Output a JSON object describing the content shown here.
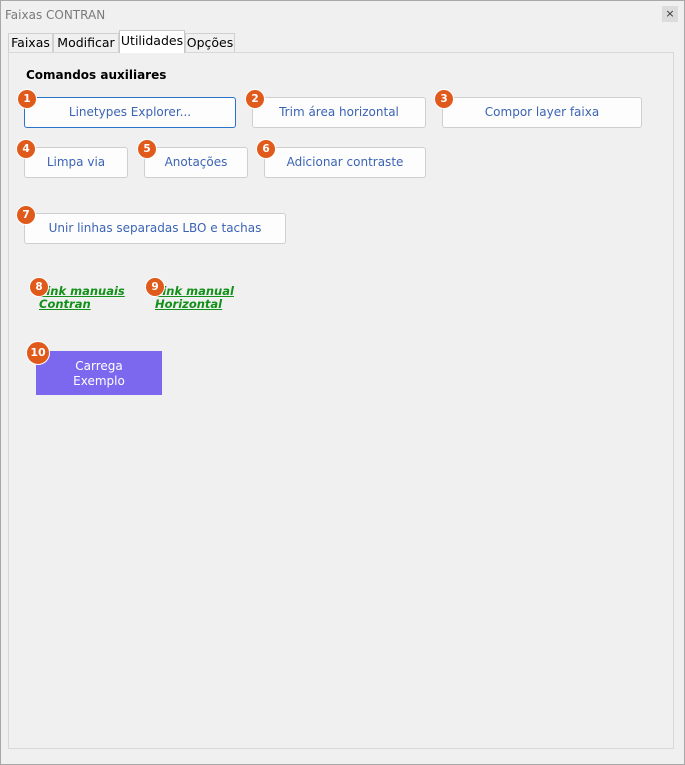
{
  "window": {
    "title": "Faixas CONTRAN",
    "close_label": "×"
  },
  "tabs": [
    {
      "label": "Faixas"
    },
    {
      "label": "Modificar"
    },
    {
      "label": "Utilidades",
      "active": true
    },
    {
      "label": "Opções"
    }
  ],
  "section": {
    "title": "Comandos auxiliares"
  },
  "buttons": {
    "linetypes": "Linetypes Explorer...",
    "trim": "Trim área horizontal",
    "compor": "Compor layer faixa",
    "limpa": "Limpa via",
    "anotacoes": "Anotações",
    "contraste": "Adicionar contraste",
    "unir": "Unir linhas separadas LBO e tachas"
  },
  "links": {
    "manuais_line1": "Link manuais",
    "manuais_line2": "Contran",
    "horizontal_line1": "Link manual",
    "horizontal_line2": "Horizontal"
  },
  "carrega": {
    "line1": "Carrega",
    "line2": "Exemplo"
  },
  "badges": [
    "1",
    "2",
    "3",
    "4",
    "5",
    "6",
    "7",
    "8",
    "9",
    "10"
  ],
  "colors": {
    "badge": "#e05a1c",
    "button_text": "#3c64b4",
    "link": "#129019",
    "carrega_bg": "#7b68ee"
  }
}
